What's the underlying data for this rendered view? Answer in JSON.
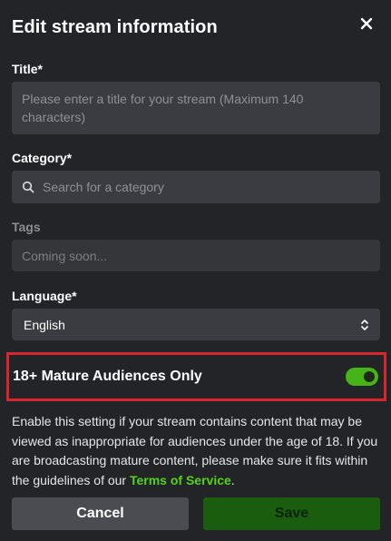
{
  "dialog": {
    "title": "Edit stream information"
  },
  "fields": {
    "title_label": "Title*",
    "title_placeholder": "Please enter a title for your stream (Maximum 140 characters)",
    "category_label": "Category*",
    "category_placeholder": "Search for a category",
    "tags_label": "Tags",
    "tags_placeholder": "Coming soon...",
    "language_label": "Language*",
    "language_value": "English"
  },
  "mature": {
    "label": "18+ Mature Audiences Only",
    "enabled": true,
    "description": "Enable this setting if your stream contains content that may be viewed as inappropriate for audiences under the age of 18. If you are broadcasting mature content, please make sure it fits within the guidelines of our ",
    "link_text": "Terms of Service",
    "trailing": "."
  },
  "actions": {
    "cancel_label": "Cancel",
    "save_label": "Save"
  },
  "colors": {
    "background": "#232428",
    "input": "#3a3c41",
    "accent_green": "#53d41a",
    "highlight_red": "#d9262e"
  },
  "icons": {
    "close": "close-icon",
    "search": "search-icon",
    "select": "chevron-updown-icon"
  }
}
